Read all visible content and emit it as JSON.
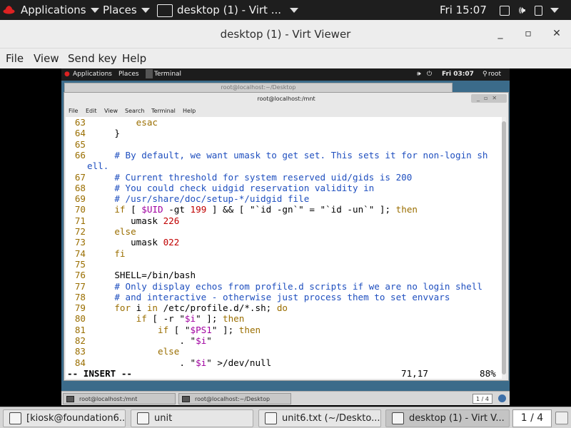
{
  "host_panel": {
    "applications": "Applications",
    "places": "Places",
    "active_window": "desktop (1) - Virt ...",
    "clock": "Fri 15:07"
  },
  "viewer": {
    "title": "desktop (1) - Virt Viewer",
    "menu": [
      "File",
      "View",
      "Send key",
      "Help"
    ]
  },
  "guest_panel": {
    "applications": "Applications",
    "places": "Places",
    "terminal": "Terminal",
    "clock": "Fri 03:07",
    "user": "root"
  },
  "bg_terminal_title": "root@localhost:~/Desktop",
  "terminal": {
    "title": "root@localhost:/mnt",
    "menu": [
      "File",
      "Edit",
      "View",
      "Search",
      "Terminal",
      "Help"
    ]
  },
  "editor": {
    "lines": [
      {
        "n": "63",
        "t": "        esac"
      },
      {
        "n": "64",
        "t": "    }"
      },
      {
        "n": "65",
        "t": ""
      },
      {
        "n": "66",
        "t": "    # By default, we want umask to get set. This sets it for non-login sh"
      },
      {
        "n": "",
        "t": "ell."
      },
      {
        "n": "67",
        "t": "    # Current threshold for system reserved uid/gids is 200"
      },
      {
        "n": "68",
        "t": "    # You could check uidgid reservation validity in"
      },
      {
        "n": "69",
        "t": "    # /usr/share/doc/setup-*/uidgid file"
      },
      {
        "n": "70",
        "t": "    if [ $UID -gt 199 ] && [ \"`id -gn`\" = \"`id -un`\" ]; then"
      },
      {
        "n": "71",
        "t": "       umask 226"
      },
      {
        "n": "72",
        "t": "    else"
      },
      {
        "n": "73",
        "t": "       umask 022"
      },
      {
        "n": "74",
        "t": "    fi"
      },
      {
        "n": "75",
        "t": ""
      },
      {
        "n": "76",
        "t": "    SHELL=/bin/bash"
      },
      {
        "n": "77",
        "t": "    # Only display echos from profile.d scripts if we are no login shell"
      },
      {
        "n": "78",
        "t": "    # and interactive - otherwise just process them to set envvars"
      },
      {
        "n": "79",
        "t": "    for i in /etc/profile.d/*.sh; do"
      },
      {
        "n": "80",
        "t": "        if [ -r \"$i\" ]; then"
      },
      {
        "n": "81",
        "t": "            if [ \"$PS1\" ]; then"
      },
      {
        "n": "82",
        "t": "                . \"$i\""
      },
      {
        "n": "83",
        "t": "            else"
      },
      {
        "n": "84",
        "t": "                . \"$i\" >/dev/null"
      }
    ],
    "mode": "-- INSERT --",
    "position": "71,17",
    "percent": "88%"
  },
  "guest_taskbar": {
    "tasks": [
      "root@localhost:/mnt",
      "root@localhost:~/Desktop"
    ],
    "pager": "1 / 4"
  },
  "host_taskbar": {
    "tasks": [
      "[kiosk@foundation6...",
      "unit",
      "unit6.txt (~/Deskto...",
      "desktop (1) - Virt V..."
    ],
    "pager": "1 / 4"
  },
  "colors": {
    "comment": "#1f4fbf",
    "keyword": "#9a6e00",
    "number": "#c00000",
    "panel": "#1e1e1e"
  }
}
